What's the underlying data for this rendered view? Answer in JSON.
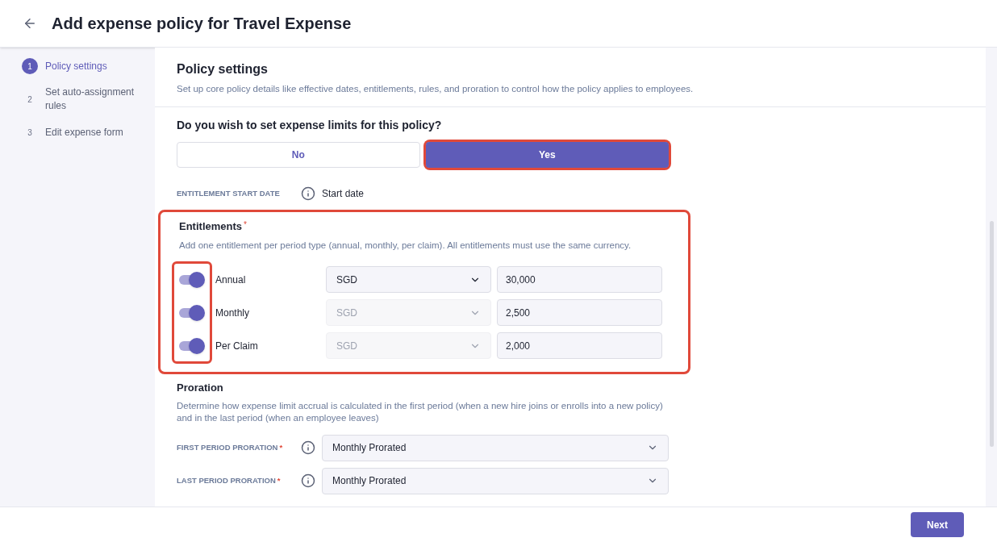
{
  "header": {
    "title": "Add expense policy for Travel Expense"
  },
  "steps": [
    {
      "number": "1",
      "label": "Policy settings",
      "selected": true
    },
    {
      "number": "2",
      "label": "Set auto-assignment rules",
      "selected": false
    },
    {
      "number": "3",
      "label": "Edit expense form",
      "selected": false
    }
  ],
  "section": {
    "title": "Policy settings",
    "description": "Set up core policy details like effective dates, entitlements, rules, and proration to control how the policy applies to employees."
  },
  "limits": {
    "question": "Do you wish to set expense limits for this policy?",
    "options": [
      {
        "label": "No",
        "selected": false,
        "highlighted": false
      },
      {
        "label": "Yes",
        "selected": true,
        "highlighted": true
      }
    ]
  },
  "start_date": {
    "label": "ENTITLEMENT START DATE",
    "value": "Start date"
  },
  "entitlements": {
    "title": "Entitlements",
    "required_mark": "*",
    "highlighted": true,
    "toggles_highlighted": true,
    "description": "Add one entitlement per period type (annual, monthly, per claim). All entitlements must use the same currency.",
    "rows": [
      {
        "label": "Annual",
        "on": true,
        "currency": "SGD",
        "currency_disabled": false,
        "amount": "30,000"
      },
      {
        "label": "Monthly",
        "on": true,
        "currency": "SGD",
        "currency_disabled": true,
        "amount": "2,500"
      },
      {
        "label": "Per Claim",
        "on": true,
        "currency": "SGD",
        "currency_disabled": true,
        "amount": "2,000"
      }
    ]
  },
  "proration": {
    "title": "Proration",
    "description": "Determine how expense limit accrual is calculated in the first period (when a new hire joins or enrolls into a new policy) and in the last period (when an employee leaves)",
    "fields": [
      {
        "label": "FIRST PERIOD PRORATION",
        "required_mark": "*",
        "value": "Monthly Prorated"
      },
      {
        "label": "LAST PERIOD PRORATION",
        "required_mark": "*",
        "value": "Monthly Prorated"
      }
    ]
  },
  "footer": {
    "next": "Next"
  }
}
